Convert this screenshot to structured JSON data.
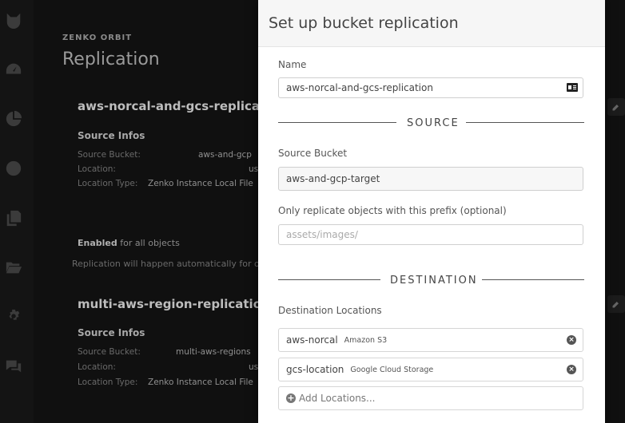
{
  "background": {
    "brand": "ZENKO ORBIT",
    "page_title": "Replication",
    "rules": [
      {
        "title": "aws-norcal-and-gcs-replicat",
        "section": "Source Infos",
        "source_bucket_label": "Source Bucket:",
        "source_bucket_value": "aws-and-gcp",
        "location_label": "Location:",
        "location_value": "us",
        "location_type_label": "Location Type:",
        "location_type_value": "Zenko Instance Local File"
      },
      {
        "title": "multi-aws-region-replication",
        "section": "Source Infos",
        "source_bucket_label": "Source Bucket:",
        "source_bucket_value": "multi-aws-regions",
        "location_label": "Location:",
        "location_value": "us",
        "location_type_label": "Location Type:",
        "location_type_value": "Zenko Instance Local File"
      }
    ],
    "enabled_bold": "Enabled",
    "enabled_rest": " for all objects",
    "auto_text": "Replication will happen automatically for o"
  },
  "rail_icons": [
    "cat-logo-icon",
    "dashboard-gauge-icon",
    "pie-chart-icon",
    "globe-icon",
    "copy-files-icon",
    "folder-open-icon",
    "gear-icon",
    "chat-bubbles-icon"
  ],
  "modal": {
    "title": "Set up bucket replication",
    "name_label": "Name",
    "name_value": "aws-norcal-and-gcs-replication",
    "source_heading": "SOURCE",
    "source_bucket_label": "Source Bucket",
    "source_bucket_value": "aws-and-gcp-target",
    "prefix_label": "Only replicate objects with this prefix (optional)",
    "prefix_placeholder": "assets/images/",
    "destination_heading": "DESTINATION",
    "destination_label": "Destination Locations",
    "locations": [
      {
        "name": "aws-norcal",
        "type": "Amazon S3"
      },
      {
        "name": "gcs-location",
        "type": "Google Cloud Storage"
      }
    ],
    "add_locations_label": "Add Locations..."
  }
}
